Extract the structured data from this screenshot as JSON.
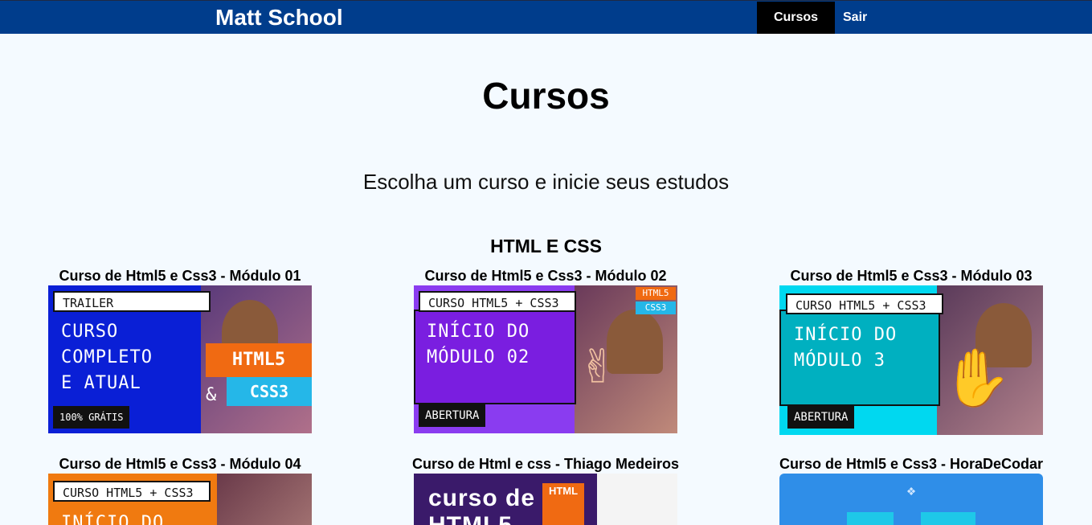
{
  "nav": {
    "brand": "Matt School",
    "links": [
      "Cursos",
      "Sair"
    ]
  },
  "page": {
    "title": "Cursos",
    "subtitle": "Escolha um curso e inicie seus estudos",
    "section": "HTML E CSS"
  },
  "courses": [
    {
      "title": "Curso de Html5 e Css3 - Módulo 01",
      "thumb": {
        "tag": "TRAILER",
        "text": "CURSO\nCOMPLETO\nE ATUAL",
        "badge": "100% GRÁTIS",
        "logo1": "HTML5",
        "logo2": "CSS3",
        "amp": "&"
      }
    },
    {
      "title": "Curso de Html5 e Css3 - Módulo 02",
      "thumb": {
        "tag": "CURSO HTML5 + CSS3",
        "text": "INÍCIO DO\nMÓDULO 02",
        "badge": "ABERTURA",
        "logo1": "HTML5",
        "logo2": "CSS3",
        "amp": "&"
      }
    },
    {
      "title": "Curso de Html5 e Css3 - Módulo 03",
      "thumb": {
        "tag": "CURSO HTML5 + CSS3",
        "text": "INÍCIO DO\nMÓDULO 3",
        "badge": "ABERTURA"
      }
    },
    {
      "title": "Curso de Html5 e Css3 - Módulo 04",
      "thumb": {
        "tag": "CURSO HTML5 + CSS3",
        "text": "INÍCIO DO"
      }
    },
    {
      "title": "Curso de Html e css - Thiago Medeiros",
      "thumb": {
        "text": "curso de\nHTML5",
        "logo1": "HTML"
      }
    },
    {
      "title": "Curso de Html5 e Css3 - HoraDeCodar",
      "thumb": {}
    }
  ]
}
